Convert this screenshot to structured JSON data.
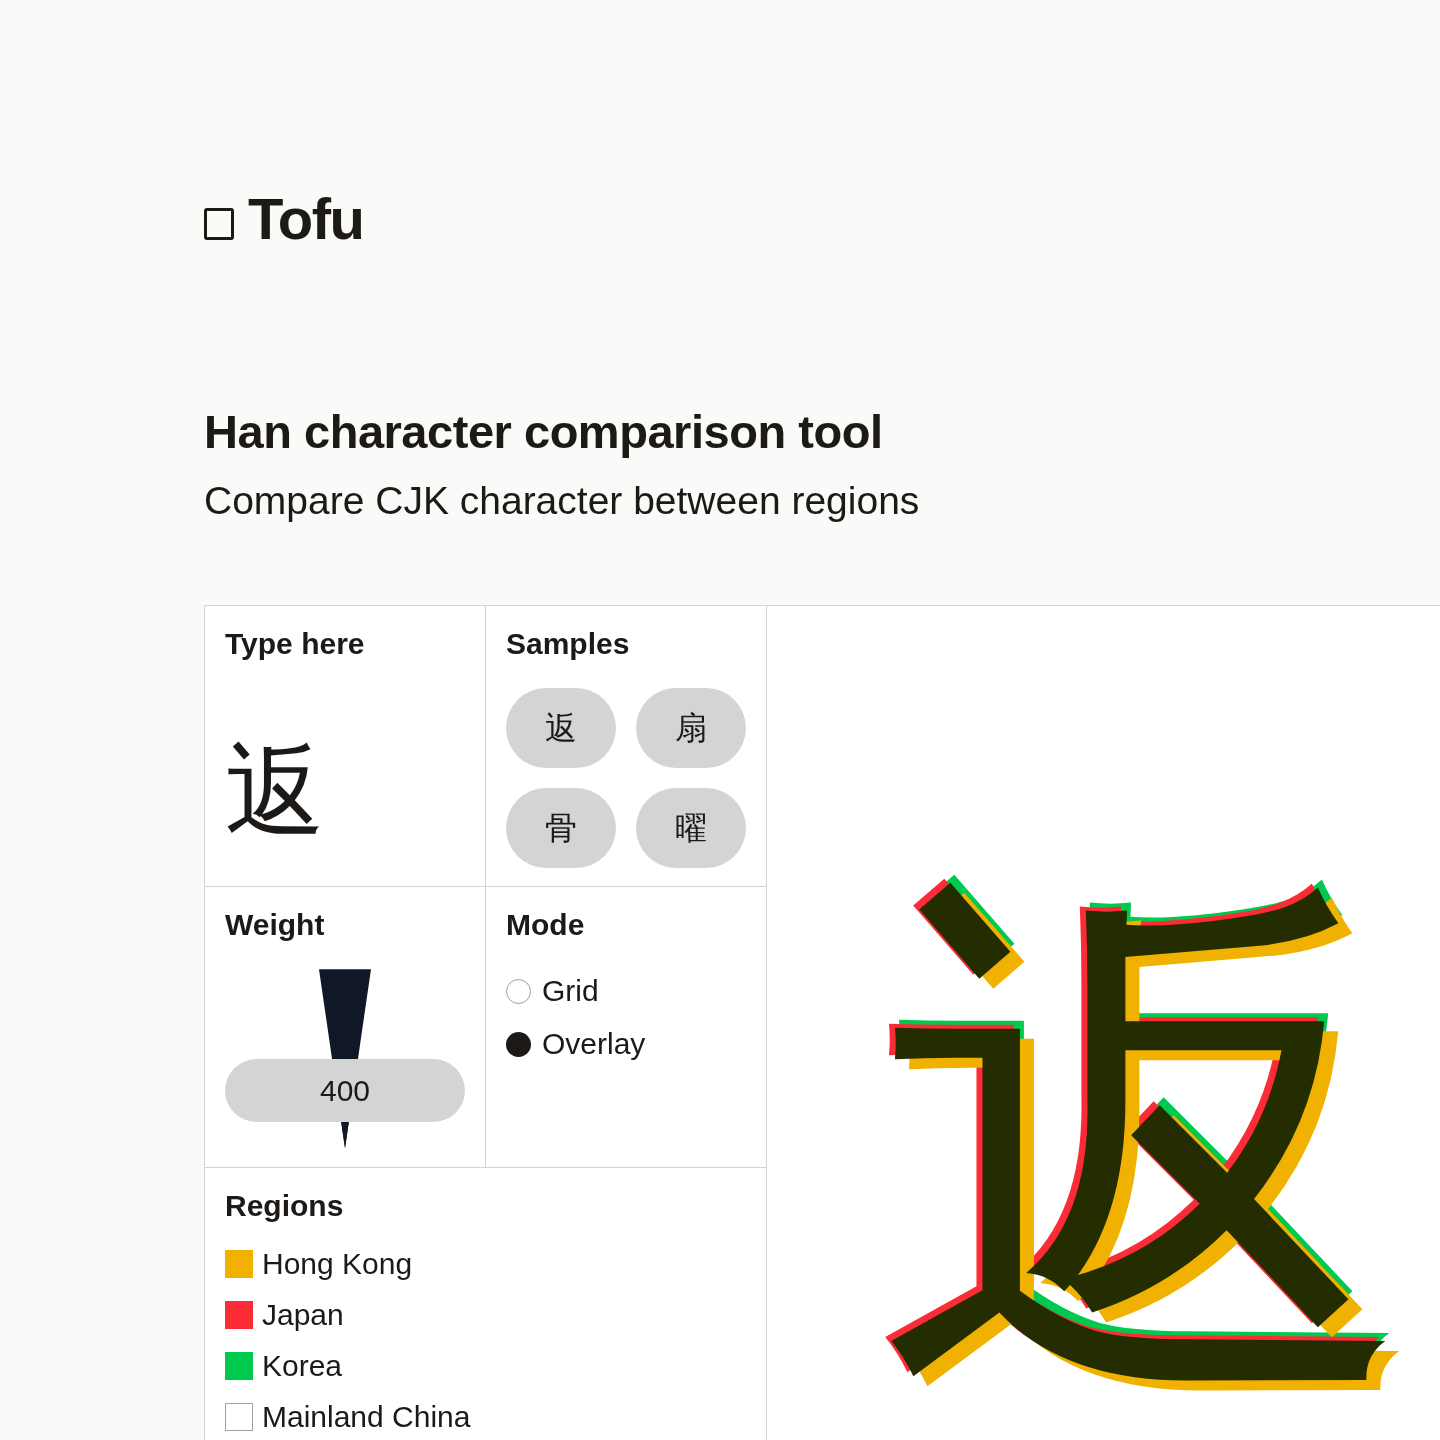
{
  "header": {
    "logo": {
      "text": "Tofu"
    }
  },
  "intro": {
    "title": "Han character comparison tool",
    "subtitle": "Compare CJK character between regions"
  },
  "input": {
    "label": "Type here",
    "value": "返"
  },
  "samples": {
    "label": "Samples",
    "items": [
      "返",
      "扇",
      "骨",
      "曜"
    ]
  },
  "weight": {
    "label": "Weight",
    "value": "400",
    "level": 0.32
  },
  "mode": {
    "label": "Mode",
    "options": [
      {
        "label": "Grid",
        "selected": false
      },
      {
        "label": "Overlay",
        "selected": true
      }
    ]
  },
  "regions": {
    "label": "Regions",
    "items": [
      {
        "label": "Hong Kong",
        "checked": true,
        "color": "#f0b100"
      },
      {
        "label": "Japan",
        "checked": true,
        "color": "#fb2c36"
      },
      {
        "label": "Korea",
        "checked": true,
        "color": "#00c950"
      },
      {
        "label": "Mainland China",
        "checked": false
      }
    ]
  },
  "preview": {
    "glyph": "返"
  }
}
